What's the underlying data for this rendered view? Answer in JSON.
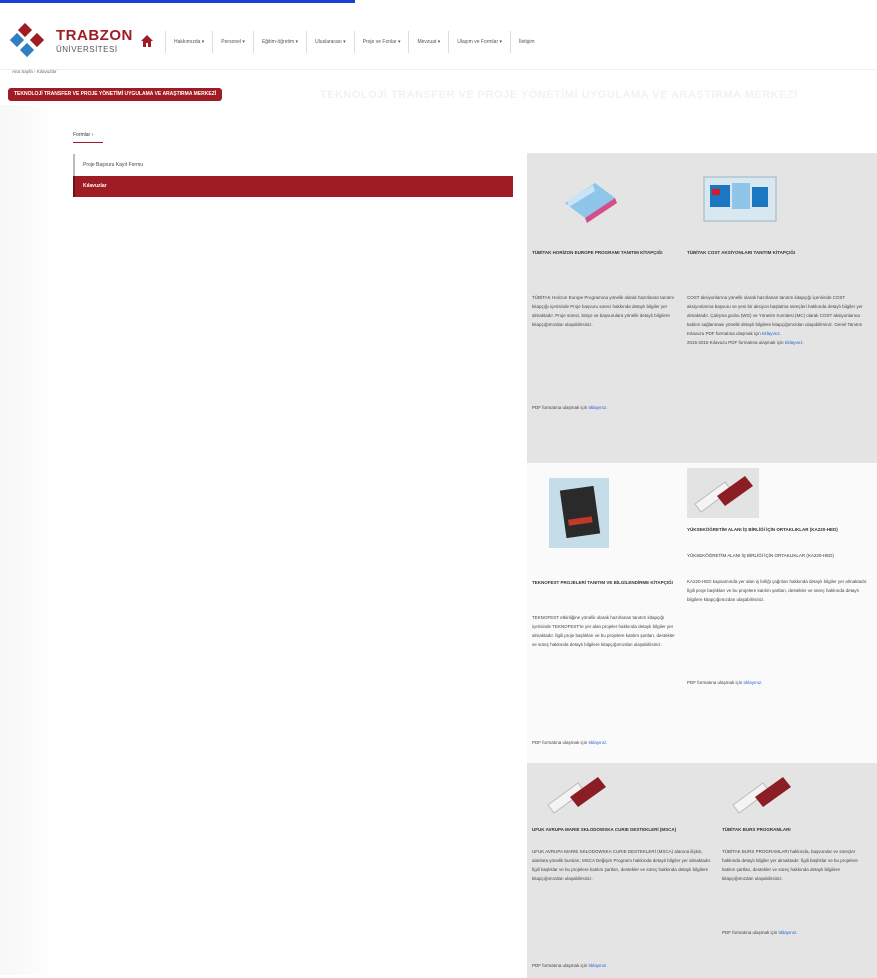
{
  "header": {
    "logo_line1": "TRABZON",
    "logo_line2": "ÜNİVERSİTESİ",
    "nav": [
      "Hakkımızda ▾",
      "Personel ▾",
      "Eğitim-öğretim ▾",
      "Uluslararası ▾",
      "Proje ve Fonlar ▾",
      "Mevzuat ▾",
      "Ulaşım ve Formlar ▾",
      "İletişim"
    ],
    "home_icon": "home-icon"
  },
  "breadcrumb": "Ana Sayfa › Kılavuzlar",
  "page_title": "TEKNOLOJİ TRANSFER VE PROJE YÖNETİMİ UYGULAMA VE ARAŞTIRMA MERKEZİ",
  "sidebar": {
    "heading": "Formlar ›",
    "items": [
      {
        "label": "Proje Başvuru Kayıt Formu"
      },
      {
        "label": "Kılavuzlar"
      }
    ]
  },
  "cards": [
    {
      "title": "TÜBİTAK HORİZON EUROPE PROGRAMI TANITIM KİTAPÇIĞI",
      "body": "TÜBİTAK Horizon Europe Programına yönelik olarak hazırlanan tanıtım kitapçığı içerisinde Proje başvuru süreci hakkında detaylı bilgiler yer almaktadır. Proje süreci, bütçe ve başvurulara yönelik detaylı bilgilere kitapçığımızdan ulaşabilirsiniz.",
      "pdf_prefix": "PDF formatına ulaşmak için",
      "pdf_link": "tıklayınız."
    },
    {
      "title": "TÜBİTAK COST AKSİYONLARI TANITIM KİTAPÇIĞI",
      "body": "COST aksiyonlarına yönelik olarak hazırlanan tanıtım kitapçığı içerisinde COST aksiyonlarına başvuru ve yeni bir aksiyon başlatma süreçleri hakkında detaylı bilgiler yer almaktadır. Çalışma grubu (WG) ve Yönetim Komitesi (MC) olarak COST aksiyonlarına katılım sağlanması yönelik detaylı bilgilere kitapçığımızdan ulaşabilirsiniz. Genel Tanıtım Kılavuzu PDF formatına ulaşmak için",
      "link1": "tıklayınız.",
      "extra": "2015-2016 Kılavuzu PDF formatına ulaşmak için",
      "link2": "tıklayınız."
    },
    {
      "title": "TEKNOFEST PROJELERİ TANITIM VE BİLGİLENDİRME KİTAPÇIĞI",
      "body": "TEKNOFEST etkinliğine yönelik olarak hazırlanan tanıtım kitapçığı içerisinde TEKNOFEST'te yer alan projeler hakkında detaylı bilgiler yer almaktadır. İlgili proje başlıkları ve bu projelere katılım şartları, destekler ve süreç hakkında detaylı bilgilere kitapçığımızdan ulaşabilirsiniz.",
      "pdf_prefix": "PDF formatına ulaşmak için",
      "pdf_link": "tıklayınız."
    },
    {
      "title": "YÜKSEKÖĞRETİM ALANI İŞ BİRLİĞİ İÇİN ORTAKLIKLAR (KA220-HED)",
      "title2": "YÜKSEKÖĞRETİM ALANI İŞ BİRLİĞİ İÇİN ORTAKLIKLAR (KA220-HED)",
      "body": "KA220-HED kapsamında yer alan iş birliği çağrıları hakkında detaylı bilgiler yer almaktadır. İlgili proje başlıkları ve bu projelere katılım şartları, destekler ve süreç hakkında detaylı bilgilere kitapçığımızdan ulaşabilirsiniz.",
      "pdf_prefix": "PDF formatına ulaşmak için",
      "pdf_link": "tıklayınız."
    },
    {
      "title": "UFUK AVRUPA MARIE SKŁODOWSKA CURIE DESTEKLERİ (MSCA)",
      "body": "UFUK AVRUPA MARIE SKŁODOWSKA CURIE DESTEKLERİ (MSCA) alanına ilişkin, alanlara yönelik bursları, MSCA Değişim Programı hakkında detaylı bilgiler yer almaktadır. İlgili başlıklar ve bu projelere katılım şartları, destekler ve süreç hakkında detaylı bilgilere kitapçığımızdan ulaşabilirsiniz.",
      "pdf_prefix": "PDF formatına ulaşmak için",
      "pdf_link": "tıklayınız."
    },
    {
      "title": "TÜBİTAK BURS PROGRAMLARI",
      "body": "TÜBİTAK BURS PROGRAMLARI hakkında, başvurular ve süreçler hakkında detaylı bilgiler yer almaktadır. İlgili başlıklar ve bu projelere katılım şartları, destekler ve süreç hakkında detaylı bilgilere kitapçığımızdan ulaşabilirsiniz.",
      "pdf_prefix": "PDF formatına ulaşmak için",
      "pdf_link": "tıklayınız."
    }
  ]
}
